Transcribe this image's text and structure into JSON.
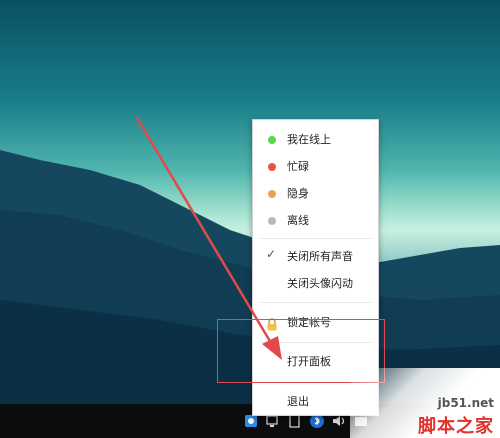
{
  "menu": {
    "status_online": "我在线上",
    "status_busy": "忙碌",
    "status_invisible": "隐身",
    "status_offline": "离线",
    "mute_all": "关闭所有声音",
    "disable_avatar_flash": "关闭头像闪动",
    "lock_account": "锁定帐号",
    "open_panel": "打开面板",
    "exit": "退出"
  },
  "colors": {
    "online": "#5ad64a",
    "busy": "#e9533f",
    "invisible": "#f0a050",
    "offline": "#b8b8b8",
    "annotation": "#e14a4a"
  },
  "watermark": {
    "url": "jb51.net",
    "text": "脚本之家"
  },
  "tray_icons": [
    "qq-icon",
    "network-icon",
    "display-icon",
    "bluetooth-icon",
    "volume-icon",
    "keyboard-icon"
  ]
}
